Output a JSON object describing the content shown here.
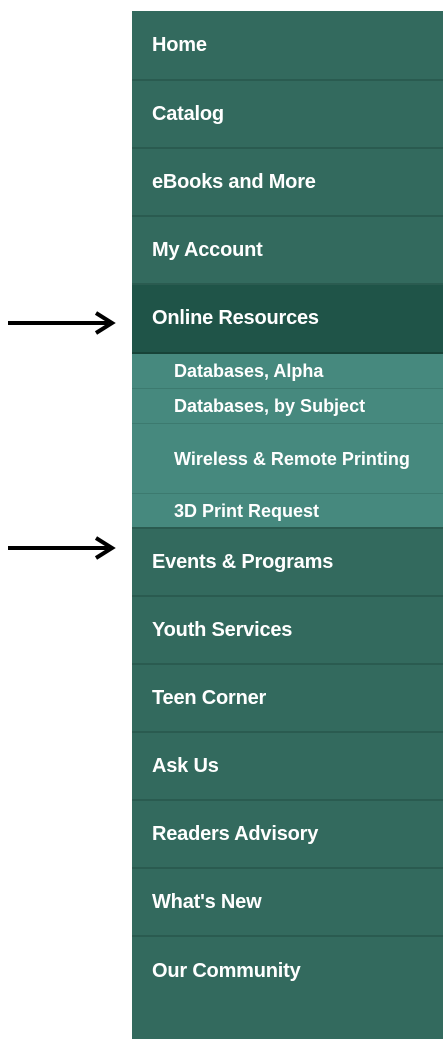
{
  "nav": {
    "items": [
      {
        "label": "Home"
      },
      {
        "label": "Catalog"
      },
      {
        "label": "eBooks and More"
      },
      {
        "label": "My Account"
      },
      {
        "label": "Online Resources"
      },
      {
        "label": "Events & Programs"
      },
      {
        "label": "Youth Services"
      },
      {
        "label": "Teen Corner"
      },
      {
        "label": "Ask Us"
      },
      {
        "label": "Readers Advisory"
      },
      {
        "label": "What's New"
      },
      {
        "label": "Our Community"
      }
    ],
    "active_label": "Online Resources",
    "subitems": [
      {
        "label": "Databases, Alpha"
      },
      {
        "label": "Databases, by Subject"
      },
      {
        "label": "Wireless & Remote Printing"
      },
      {
        "label": "3D Print Request"
      }
    ]
  },
  "annotations": {
    "arrows": [
      {
        "icon": "right-arrow-icon",
        "points_to": "Online Resources"
      },
      {
        "icon": "right-arrow-icon",
        "points_to": "3D Print Request"
      }
    ]
  },
  "colors": {
    "nav_background": "#336a5e",
    "active_background": "#1f5448",
    "submenu_background": "#46897e",
    "text": "#ffffff",
    "arrow": "#000000"
  }
}
